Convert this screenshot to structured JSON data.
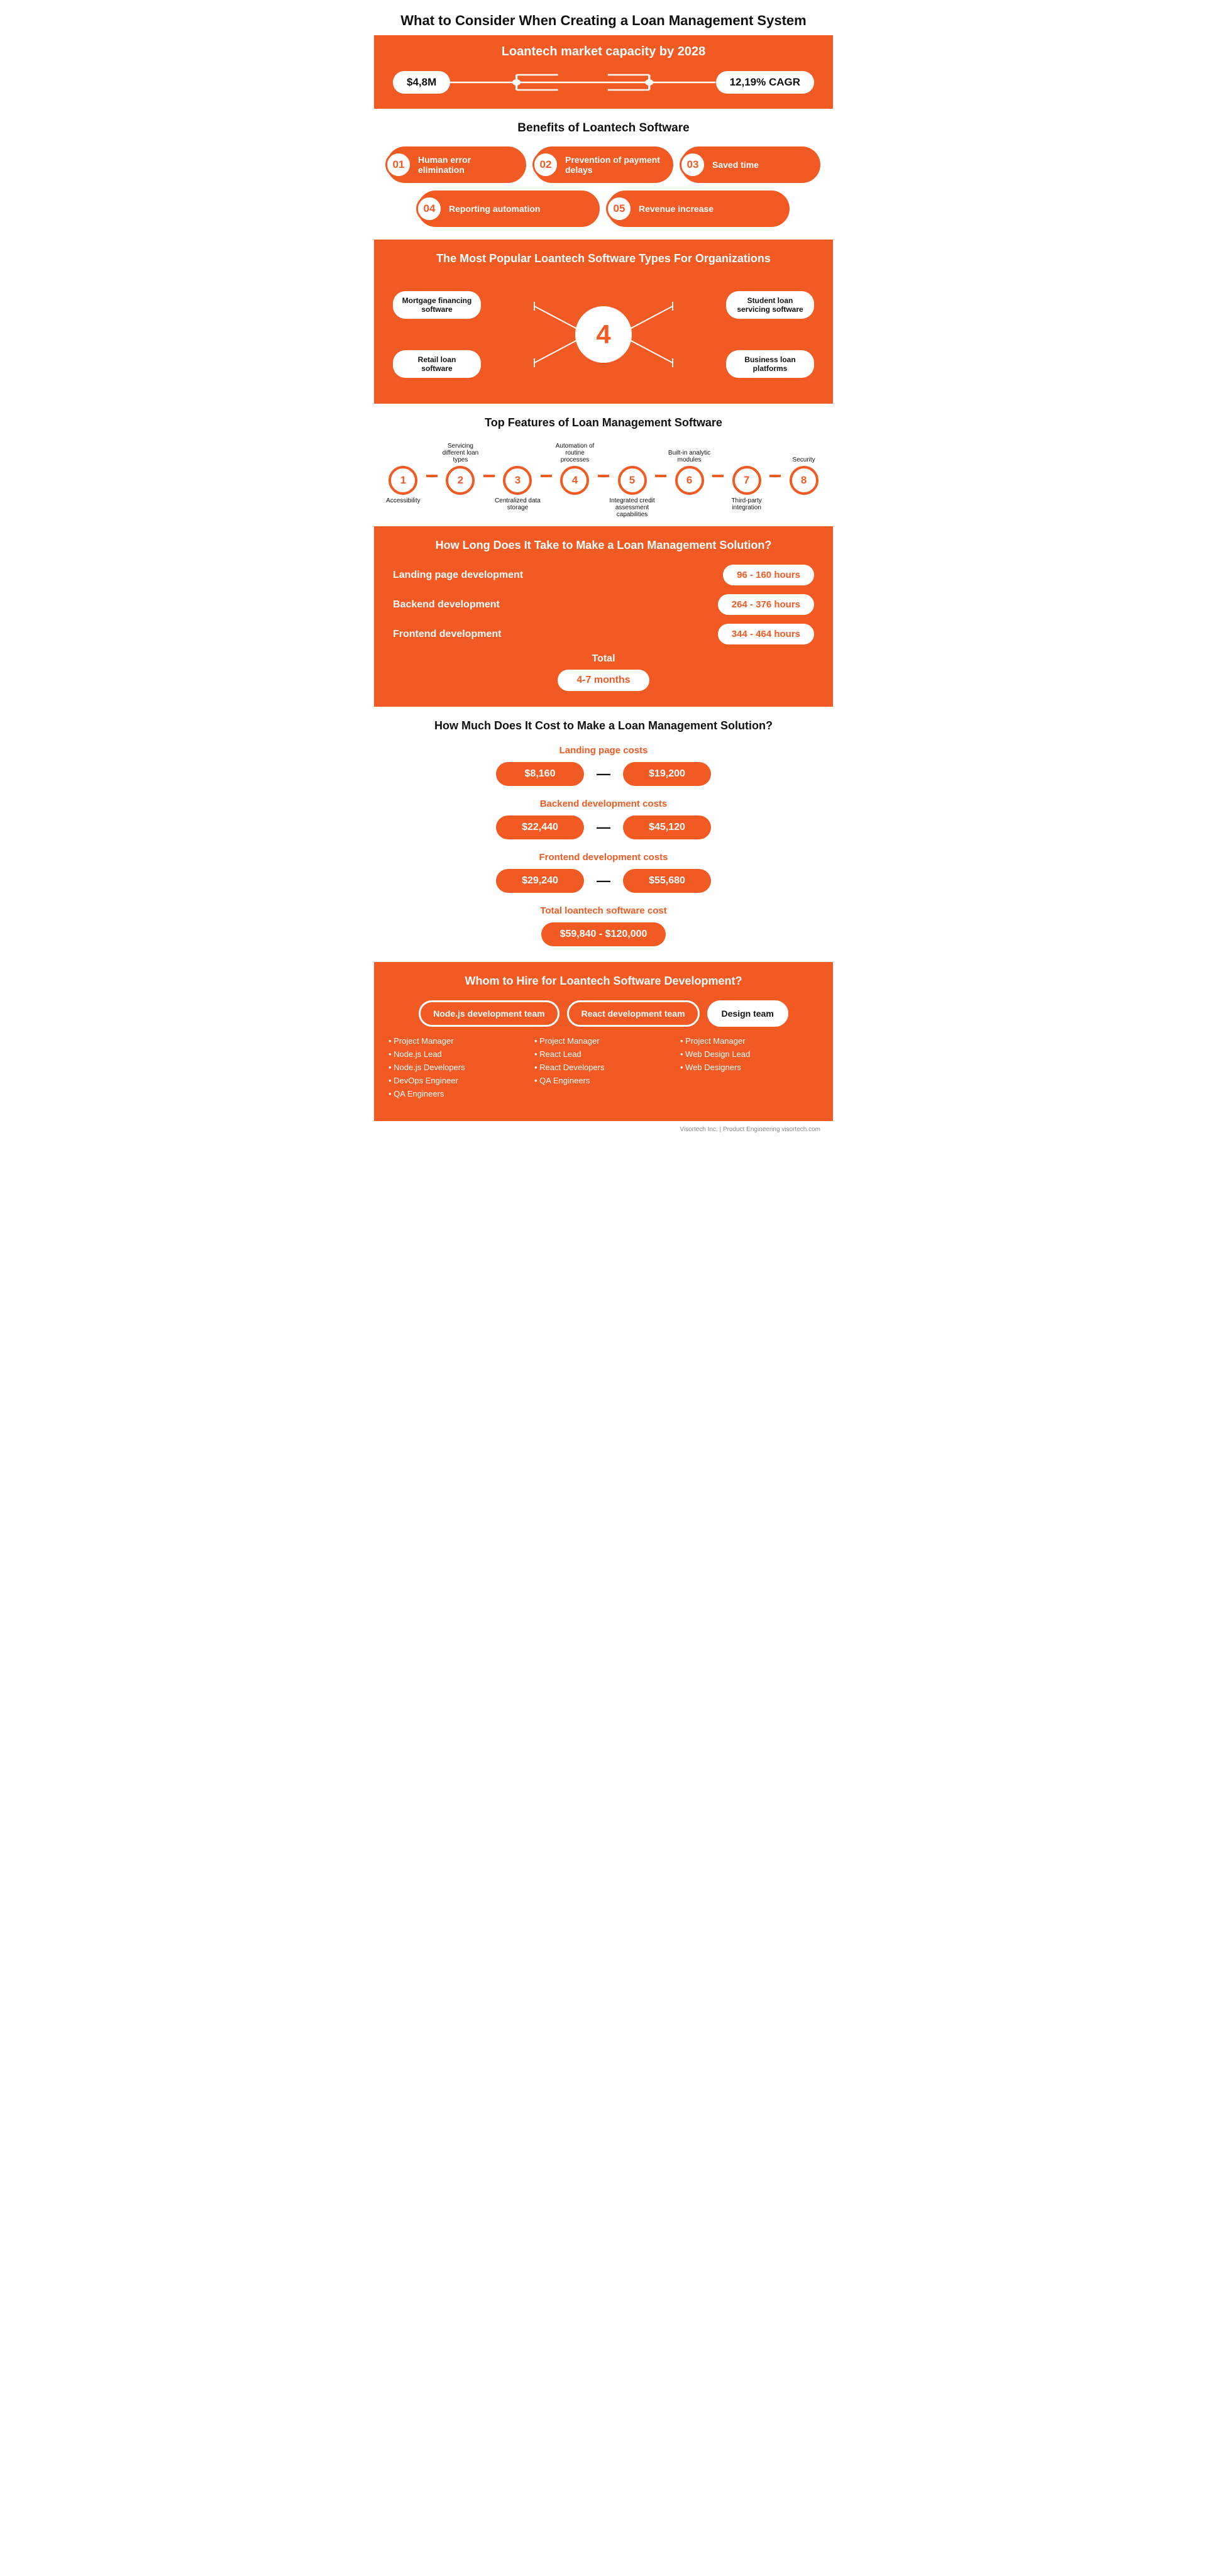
{
  "title": "What to Consider When Creating a Loan Management System",
  "market": {
    "title": "Loantech market capacity by 2028",
    "value1": "$4,8M",
    "value2": "12,19% CAGR"
  },
  "benefits": {
    "section_title": "Benefits of Loantech Software",
    "items": [
      {
        "num": "01",
        "text": "Human error elimination"
      },
      {
        "num": "02",
        "text": "Prevention of payment delays"
      },
      {
        "num": "03",
        "text": "Saved time"
      },
      {
        "num": "04",
        "text": "Reporting automation"
      },
      {
        "num": "05",
        "text": "Revenue increase"
      }
    ]
  },
  "popular": {
    "title": "The Most Popular Loantech Software Types For Organizations",
    "center_num": "4",
    "labels": [
      {
        "text": "Mortgage financing software",
        "side": "left"
      },
      {
        "text": "Student loan servicing software",
        "side": "right"
      },
      {
        "text": "Retail loan software",
        "side": "left"
      },
      {
        "text": "Business loan platforms",
        "side": "right"
      }
    ]
  },
  "features": {
    "title": "Top Features of Loan Management Software",
    "items": [
      {
        "num": "1",
        "label_top": "",
        "label_bottom": "Accessibility"
      },
      {
        "num": "2",
        "label_top": "Servicing different loan types",
        "label_bottom": ""
      },
      {
        "num": "3",
        "label_top": "",
        "label_bottom": "Centralized data storage"
      },
      {
        "num": "4",
        "label_top": "Automation of routine processes",
        "label_bottom": ""
      },
      {
        "num": "5",
        "label_top": "",
        "label_bottom": "Integrated credit assessment capabilities"
      },
      {
        "num": "6",
        "label_top": "Built-in analytic modules",
        "label_bottom": ""
      },
      {
        "num": "7",
        "label_top": "",
        "label_bottom": "Third-party integration"
      },
      {
        "num": "8",
        "label_top": "Security",
        "label_bottom": ""
      }
    ]
  },
  "howlong": {
    "title": "How Long Does It Take to Make a Loan Management Solution?",
    "rows": [
      {
        "label": "Landing page development",
        "value": "96 - 160 hours"
      },
      {
        "label": "Backend development",
        "value": "264 - 376 hours"
      },
      {
        "label": "Frontend development",
        "value": "344 - 464 hours"
      }
    ],
    "total_label": "Total",
    "total_value": "4-7 months"
  },
  "howmuch": {
    "title": "How Much Does It Cost to Make a Loan Management Solution?",
    "groups": [
      {
        "title": "Landing page costs",
        "value1": "$8,160",
        "value2": "$19,200"
      },
      {
        "title": "Backend development costs",
        "value1": "$22,440",
        "value2": "$45,120"
      },
      {
        "title": "Frontend development costs",
        "value1": "$29,240",
        "value2": "$55,680"
      }
    ],
    "total_title": "Total loantech software cost",
    "total_value": "$59,840 - $120,000"
  },
  "hire": {
    "title": "Whom to Hire for Loantech Software Development?",
    "teams": [
      {
        "label": "Node.js development team",
        "style": "orange-outline"
      },
      {
        "label": "React development team",
        "style": "orange-outline"
      },
      {
        "label": "Design team",
        "style": "white-fill"
      }
    ],
    "details": [
      {
        "items": [
          "• Project Manager",
          "• Node.js Lead",
          "• Node.js Developers",
          "• DevOps Engineer",
          "• QA Engineers"
        ]
      },
      {
        "items": [
          "• Project Manager",
          "• React Lead",
          "• React Developers",
          "• QA Engineers"
        ]
      },
      {
        "items": [
          "• Project Manager",
          "• Web Design Lead",
          "• Web Designers"
        ]
      }
    ]
  },
  "footer": {
    "text": "Visortech Inc. | Product Engineering  visortech.com"
  }
}
